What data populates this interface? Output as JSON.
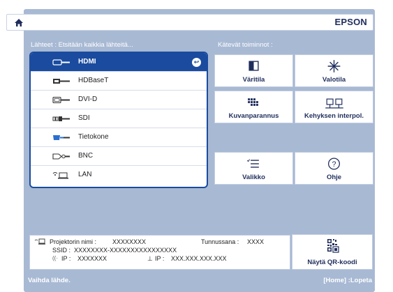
{
  "header": {
    "brand": "EPSON",
    "home_icon": "home-icon"
  },
  "sources": {
    "label": "Lähteet : Etsitään kaikkia lähteitä...",
    "items": [
      {
        "label": "HDMI",
        "icon": "hdmi-port-icon",
        "selected": true
      },
      {
        "label": "HDBaseT",
        "icon": "hdbaset-port-icon",
        "selected": false
      },
      {
        "label": "DVI-D",
        "icon": "dvi-port-icon",
        "selected": false
      },
      {
        "label": "SDI",
        "icon": "sdi-port-icon",
        "selected": false
      },
      {
        "label": "Tietokone",
        "icon": "computer-port-icon",
        "selected": false
      },
      {
        "label": "BNC",
        "icon": "bnc-port-icon",
        "selected": false
      },
      {
        "label": "LAN",
        "icon": "lan-port-icon",
        "selected": false
      }
    ]
  },
  "functions": {
    "label": "Kätevät toiminnot :",
    "buttons": [
      {
        "label": "Väritila",
        "icon": "color-mode-icon"
      },
      {
        "label": "Valotila",
        "icon": "light-mode-icon"
      },
      {
        "label": "Kuvanparannus",
        "icon": "image-enhancement-icon"
      },
      {
        "label": "Kehyksen interpol.",
        "icon": "frame-interpolation-icon"
      },
      {
        "label": "Valikko",
        "icon": "menu-icon"
      },
      {
        "label": "Ohje",
        "icon": "help-icon"
      }
    ]
  },
  "info": {
    "projector_name_label": "Projektorin nimi :",
    "projector_name": "XXXXXXXX",
    "passphrase_label": "Tunnussana :",
    "passphrase": "XXXX",
    "ssid_label": "SSID :",
    "ssid": "XXXXXXXX-XXXXXXXXXXXXXXXX",
    "wireless_ip_label": "IP :",
    "wireless_ip": "XXXXXXX",
    "wired_ip_label": "IP :",
    "wired_ip": "XXX.XXX.XXX.XXX"
  },
  "qr": {
    "label": "Näytä QR-koodi"
  },
  "footer": {
    "left": "Vaihda lähde.",
    "right": "[Home] :Lopeta"
  }
}
